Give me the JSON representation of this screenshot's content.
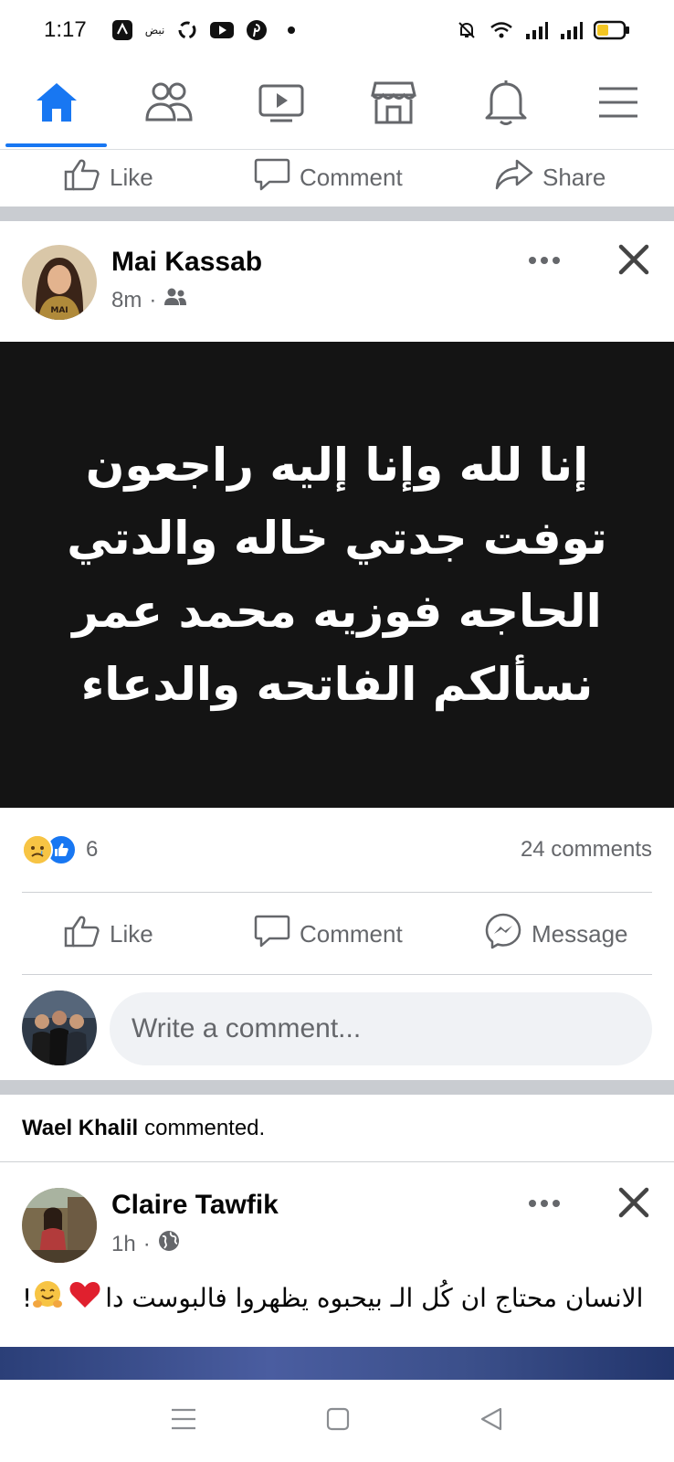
{
  "status_bar": {
    "time": "1:17",
    "carrier_text": "نبض",
    "left_icons": [
      "app-logo-icon",
      "recycle-icon",
      "youtube-icon",
      "pinterest-icon",
      "dot-icon"
    ],
    "right_icons": [
      "mute-icon",
      "wifi-icon",
      "signal-icon",
      "signal-icon",
      "battery-icon"
    ]
  },
  "nav": {
    "tabs": [
      {
        "name": "home",
        "icon": "home-icon",
        "active": true
      },
      {
        "name": "friends",
        "icon": "friends-icon",
        "active": false
      },
      {
        "name": "watch",
        "icon": "video-icon",
        "active": false
      },
      {
        "name": "marketplace",
        "icon": "marketplace-icon",
        "active": false
      },
      {
        "name": "notifications",
        "icon": "bell-icon",
        "active": false
      },
      {
        "name": "menu",
        "icon": "hamburger-icon",
        "active": false
      }
    ],
    "accent_color": "#1877f2"
  },
  "prev_post_actions": {
    "like": "Like",
    "comment": "Comment",
    "share": "Share"
  },
  "post1": {
    "author": "Mai Kassab",
    "time": "8m",
    "separator": "·",
    "audience_icon": "friends-icon",
    "image_lines": [
      "إنا لله وإنا إليه راجعون",
      "توفت جدتي خاله والدتي",
      "الحاجه فوزيه محمد عمر",
      "نسألكم الفاتحه والدعاء"
    ],
    "reactions": [
      "sad",
      "like"
    ],
    "reaction_count": "6",
    "comments": "24 comments",
    "actions": {
      "like": "Like",
      "comment": "Comment",
      "message": "Message"
    }
  },
  "comment_box": {
    "placeholder": "Write a comment..."
  },
  "activity": {
    "name": "Wael Khalil",
    "action": "commented."
  },
  "post2": {
    "author": "Claire Tawfik",
    "time": "1h",
    "separator": "·",
    "audience_icon": "globe-icon",
    "text": "الانسان محتاج ان كُل الـ بيحبوه يظهروا فالبوست دا",
    "text_end": "!"
  },
  "android_nav": [
    "menu-icon",
    "home-square-icon",
    "back-icon"
  ]
}
